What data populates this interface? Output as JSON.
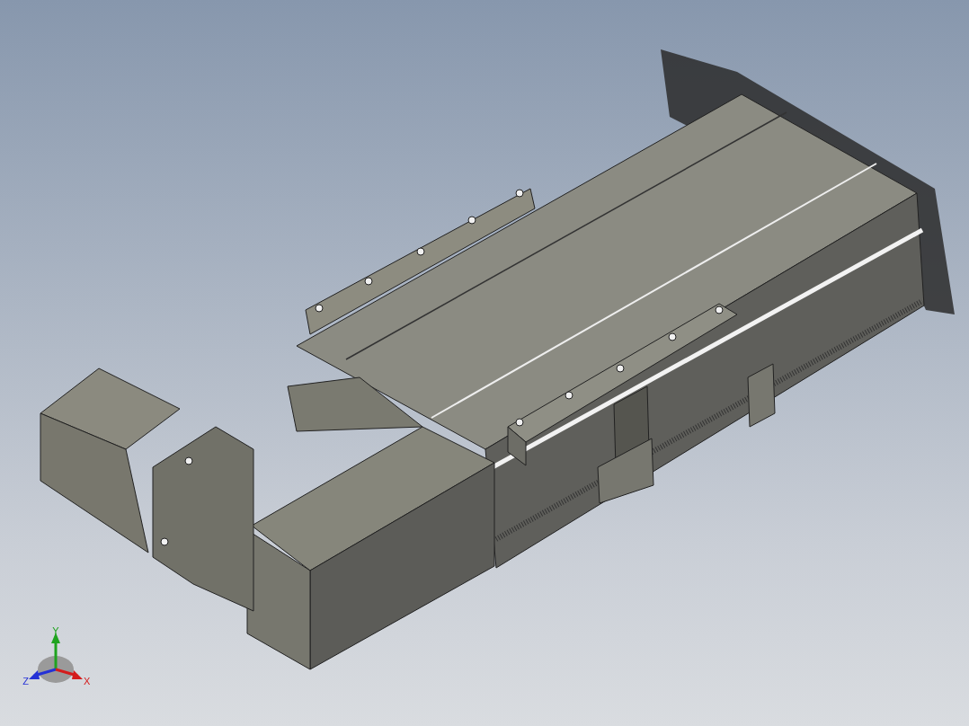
{
  "viewport": {
    "triad": {
      "axes": [
        {
          "kind": "y",
          "label": "Y",
          "color": "#1fa31f"
        },
        {
          "kind": "z",
          "label": "Z",
          "color": "#2431d6"
        },
        {
          "kind": "x",
          "label": "X",
          "color": "#d41c1c"
        }
      ]
    }
  }
}
